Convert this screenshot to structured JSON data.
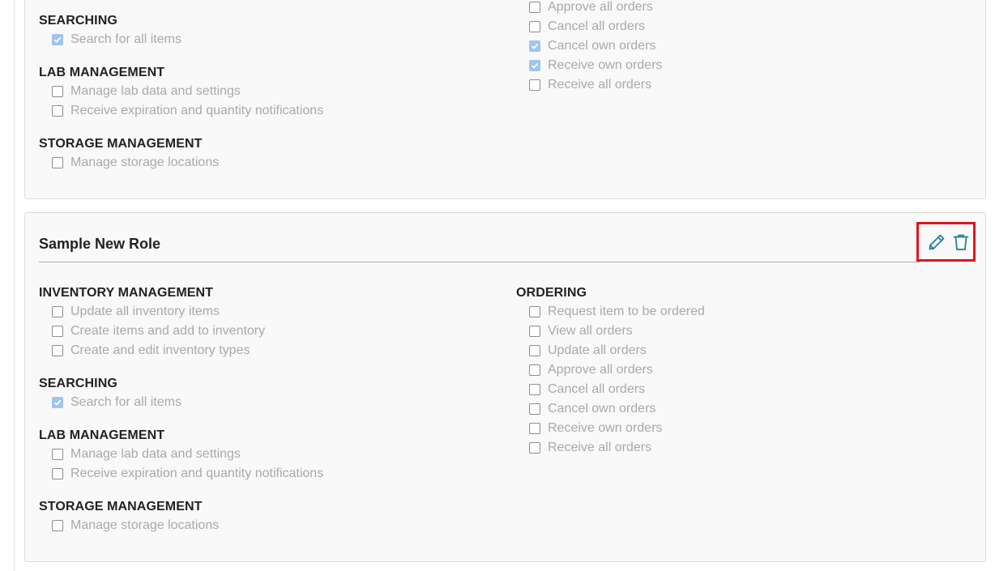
{
  "colors": {
    "accent": "#1a7f96",
    "checkbox_checked": "#9ec5ee",
    "highlight_box": "#e0161d"
  },
  "card1": {
    "searching": {
      "title": "SEARCHING",
      "items": [
        {
          "label": "Search for all items",
          "checked": true
        }
      ]
    },
    "lab_management": {
      "title": "LAB MANAGEMENT",
      "items": [
        {
          "label": "Manage lab data and settings",
          "checked": false
        },
        {
          "label": "Receive expiration and quantity notifications",
          "checked": false
        }
      ]
    },
    "storage_management": {
      "title": "STORAGE MANAGEMENT",
      "items": [
        {
          "label": "Manage storage locations",
          "checked": false
        }
      ]
    },
    "ordering": {
      "items": [
        {
          "label": "Approve all orders",
          "checked": false
        },
        {
          "label": "Cancel all orders",
          "checked": false
        },
        {
          "label": "Cancel own orders",
          "checked": true
        },
        {
          "label": "Receive own orders",
          "checked": true
        },
        {
          "label": "Receive all orders",
          "checked": false
        }
      ]
    }
  },
  "card2": {
    "role_name": "Sample New Role",
    "actions": {
      "edit_icon": "pencil-icon",
      "delete_icon": "trash-icon"
    },
    "inventory_management": {
      "title": "INVENTORY MANAGEMENT",
      "items": [
        {
          "label": "Update all inventory items",
          "checked": false
        },
        {
          "label": "Create items and add to inventory",
          "checked": false
        },
        {
          "label": "Create and edit inventory types",
          "checked": false
        }
      ]
    },
    "searching": {
      "title": "SEARCHING",
      "items": [
        {
          "label": "Search for all items",
          "checked": true
        }
      ]
    },
    "lab_management": {
      "title": "LAB MANAGEMENT",
      "items": [
        {
          "label": "Manage lab data and settings",
          "checked": false
        },
        {
          "label": "Receive expiration and quantity notifications",
          "checked": false
        }
      ]
    },
    "storage_management": {
      "title": "STORAGE MANAGEMENT",
      "items": [
        {
          "label": "Manage storage locations",
          "checked": false
        }
      ]
    },
    "ordering": {
      "title": "ORDERING",
      "items": [
        {
          "label": "Request item to be ordered",
          "checked": false
        },
        {
          "label": "View all orders",
          "checked": false
        },
        {
          "label": "Update all orders",
          "checked": false
        },
        {
          "label": "Approve all orders",
          "checked": false
        },
        {
          "label": "Cancel all orders",
          "checked": false
        },
        {
          "label": "Cancel own orders",
          "checked": false
        },
        {
          "label": "Receive own orders",
          "checked": false
        },
        {
          "label": "Receive all orders",
          "checked": false
        }
      ]
    }
  }
}
